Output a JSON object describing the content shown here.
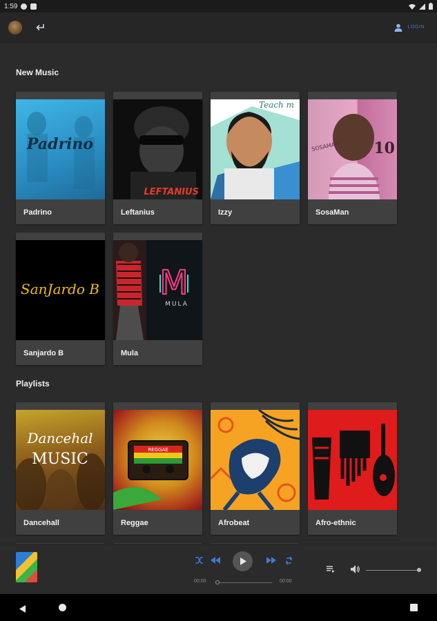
{
  "status_bar": {
    "time": "1:59"
  },
  "app_bar": {
    "login_label": "LOGIN"
  },
  "sections": {
    "new_music": {
      "title": "New Music",
      "items": [
        {
          "label": "Padrino"
        },
        {
          "label": "Leftanius"
        },
        {
          "label": "Izzy"
        },
        {
          "label": "SosaMan"
        },
        {
          "label": "Sanjardo B"
        },
        {
          "label": "Mula"
        }
      ]
    },
    "playlists": {
      "title": "Playlists",
      "items": [
        {
          "label": "Dancehall"
        },
        {
          "label": "Reggae"
        },
        {
          "label": "Afrobeat"
        },
        {
          "label": "Afro-ethnic"
        }
      ]
    }
  },
  "cover_text": {
    "padrino": "Padrino",
    "leftanius": "LEFTANIUS",
    "izzy": "Teach m",
    "sosaman": "SOSAMAN",
    "sosaman_number": "10",
    "sanjardo": "SanJardo B",
    "mula_letter": "M",
    "mula_name": "MULA",
    "dancehall_1": "Dancehal",
    "dancehall_2": "MUSIC",
    "reggae": "REGGAE"
  },
  "player": {
    "elapsed": "00:00",
    "duration": "00:00",
    "progress": 0,
    "volume": 1.0
  },
  "colors": {
    "accent": "#3d7bd6",
    "background": "#2b2b2b",
    "card": "#404040"
  }
}
